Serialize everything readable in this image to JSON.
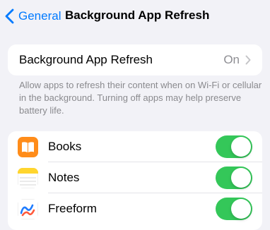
{
  "navbar": {
    "back_label": "General",
    "title": "Background App Refresh"
  },
  "setting": {
    "label": "Background App Refresh",
    "value": "On"
  },
  "footnote": "Allow apps to refresh their content when on Wi-Fi or cellular in the background. Turning off apps may help preserve battery life.",
  "apps": [
    {
      "name": "Books",
      "icon": "books-icon",
      "enabled": true
    },
    {
      "name": "Notes",
      "icon": "notes-icon",
      "enabled": true
    },
    {
      "name": "Freeform",
      "icon": "freeform-icon",
      "enabled": true
    }
  ],
  "colors": {
    "background": "#f2f2f7",
    "accent": "#007aff",
    "toggle_on": "#34c759",
    "secondary_text": "#8e8e93"
  }
}
